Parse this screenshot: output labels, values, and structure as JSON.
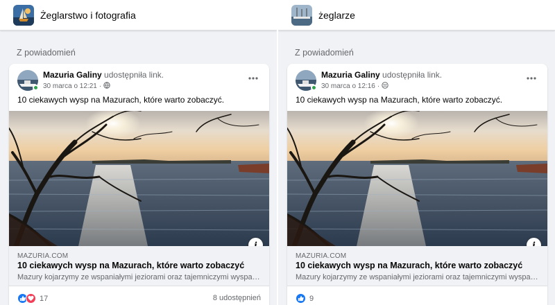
{
  "columns": [
    {
      "group": {
        "name": "Żeglarstwo i fotografia",
        "avatar_icon": "sailboat-photo-icon"
      },
      "section_label": "Z powiadomień",
      "post": {
        "author": "Mazuria Galiny",
        "action": "udostępniła link.",
        "date": "30 marca o 12:21",
        "audience_icon": "globe-icon",
        "text": "10 ciekawych wysp na Mazurach, które warto zobaczyć.",
        "link": {
          "domain": "MAZURIA.COM",
          "title": "10 ciekawych wysp na Mazurach, które warto zobaczyć",
          "description": "Mazury kojarzymy ze wspaniałymi jeziorami oraz tajemniczymi wyspami..."
        },
        "reactions": {
          "icons": [
            "like-icon",
            "love-icon"
          ],
          "count": "17"
        },
        "shares": "8 udostępnień"
      }
    },
    {
      "group": {
        "name": "żeglarze",
        "avatar_icon": "harbor-photo-icon"
      },
      "section_label": "Z powiadomień",
      "post": {
        "author": "Mazuria Galiny",
        "action": "udostępniła link.",
        "date": "30 marca o 12:16",
        "audience_icon": "group-icon",
        "text": "10 ciekawych wysp na Mazurach, które warto zobaczyć.",
        "link": {
          "domain": "MAZURIA.COM",
          "title": "10 ciekawych wysp na Mazurach, które warto zobaczyć",
          "description": "Mazury kojarzymy ze wspaniałymi jeziorami oraz tajemniczymi wyspami..."
        },
        "reactions": {
          "icons": [
            "like-icon"
          ],
          "count": "9"
        },
        "shares": ""
      }
    }
  ],
  "colors": {
    "accent": "#1877f2",
    "love": "#f33e58",
    "online": "#31a24c",
    "secondary_text": "#65676b",
    "background": "#f0f2f5"
  }
}
